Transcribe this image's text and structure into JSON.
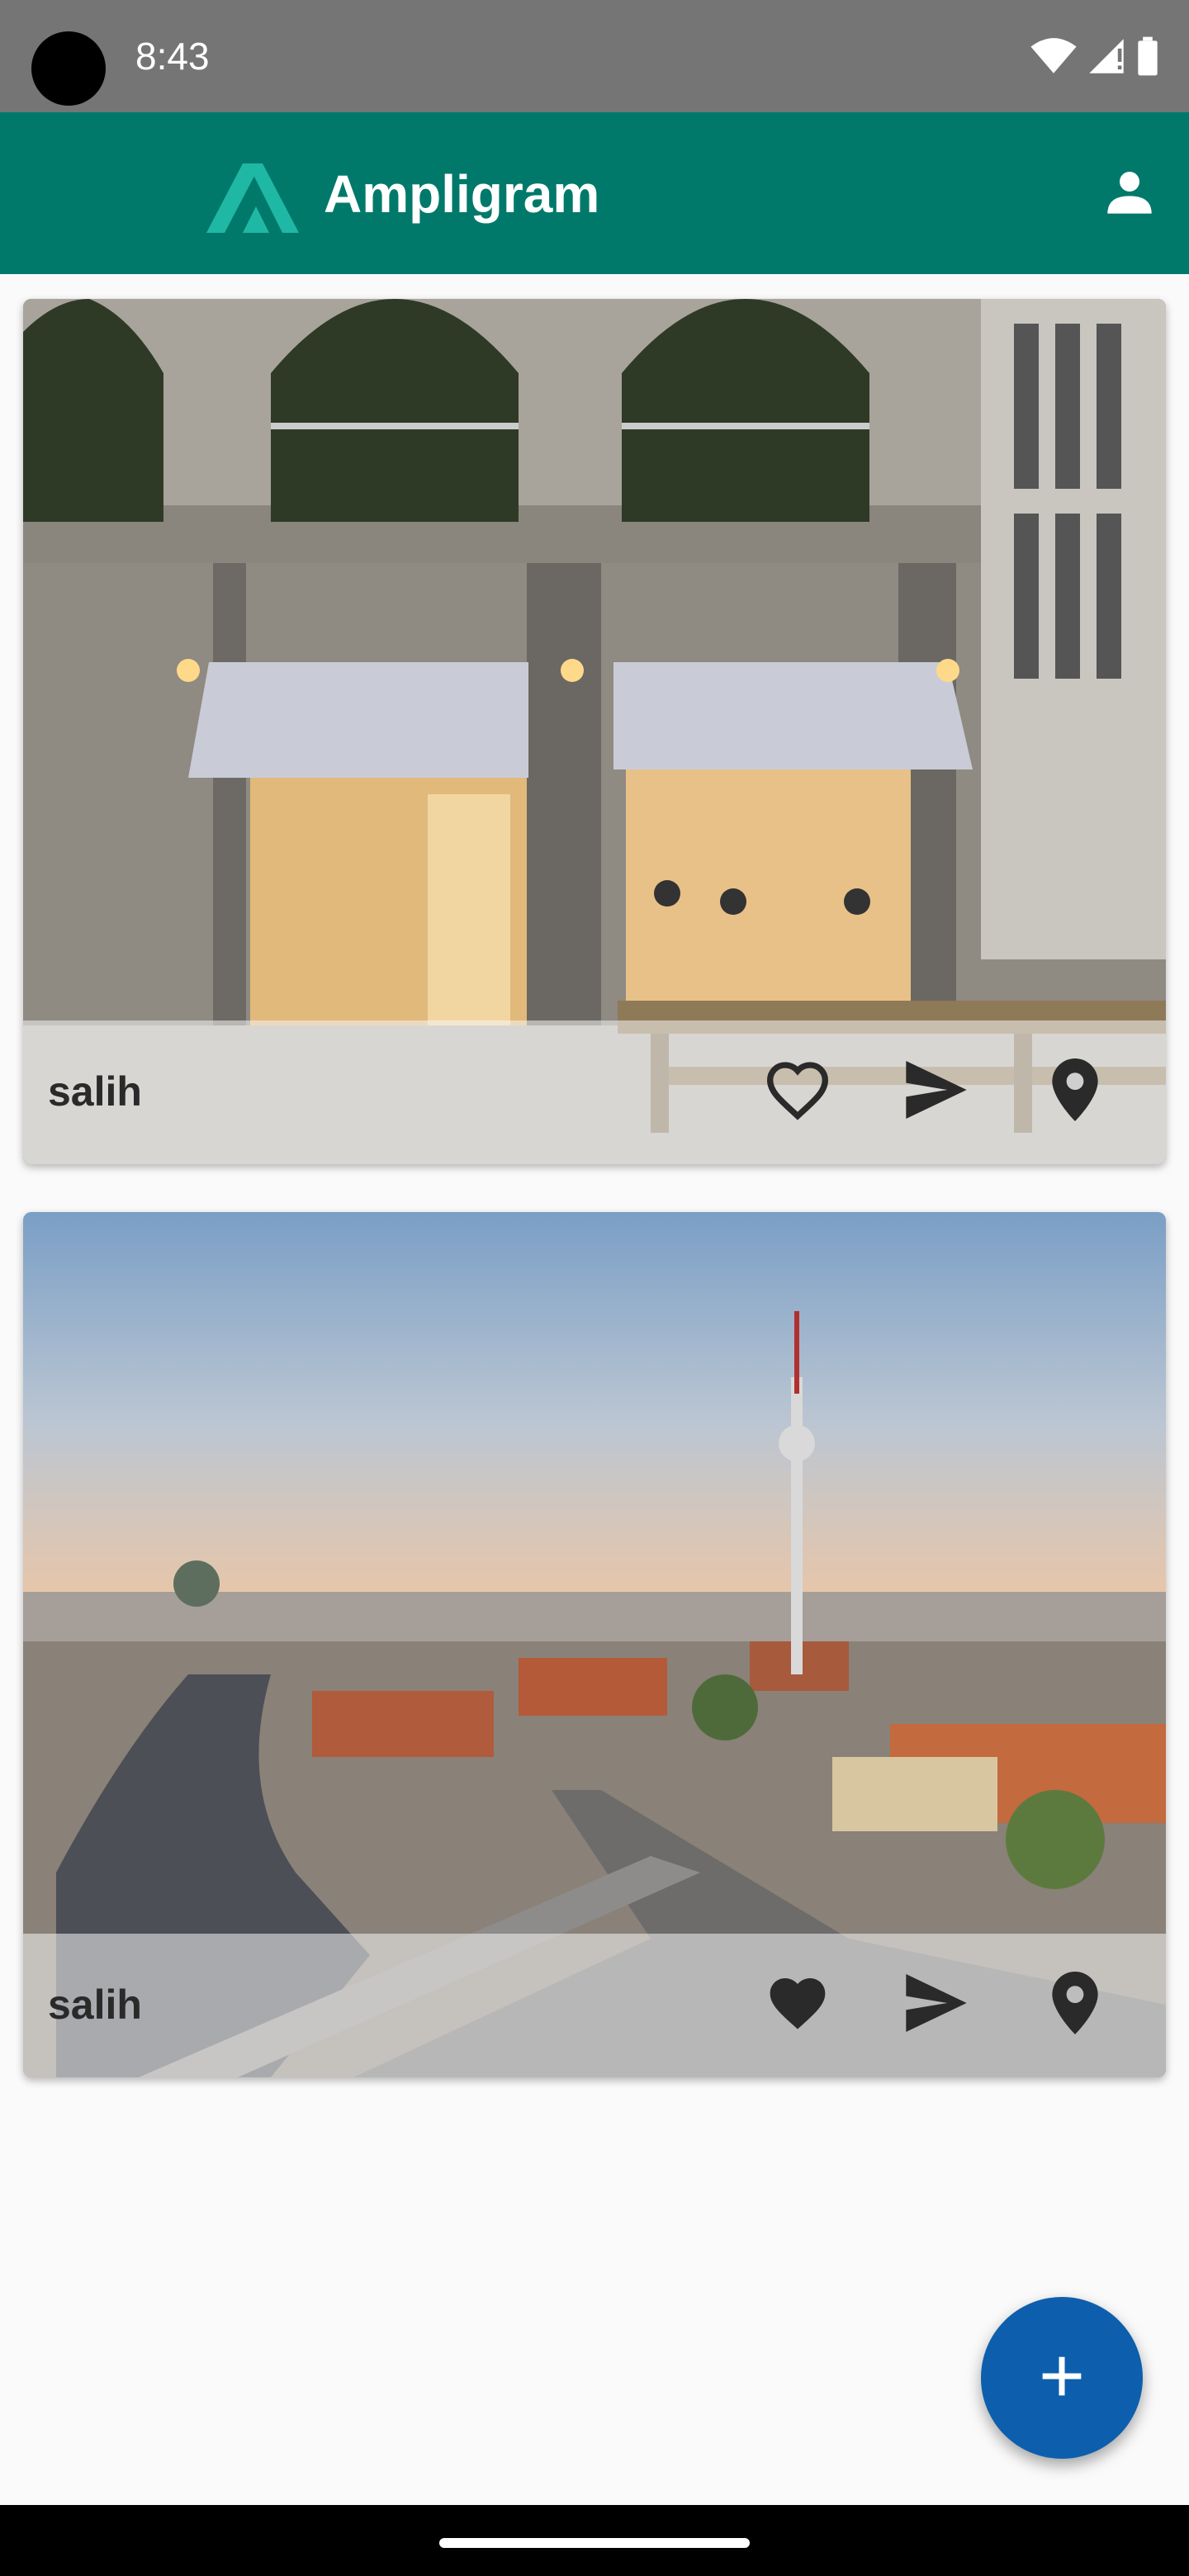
{
  "status_bar": {
    "time": "8:43",
    "icons": [
      "wifi-icon",
      "cell-signal-icon",
      "battery-icon"
    ]
  },
  "app_bar": {
    "title": "Ampligram",
    "logo_icon": "ampligram-logo-icon",
    "profile_icon": "account-icon",
    "background_color": "#00796b"
  },
  "feed": {
    "posts": [
      {
        "username": "salih",
        "liked": false,
        "like_icon": "heart-outline-icon",
        "share_icon": "send-icon",
        "location_icon": "map-pin-icon"
      },
      {
        "username": "salih",
        "liked": true,
        "like_icon": "heart-filled-icon",
        "share_icon": "send-icon",
        "location_icon": "map-pin-icon"
      }
    ]
  },
  "fab": {
    "icon": "plus-icon",
    "color": "#0d5fad"
  }
}
